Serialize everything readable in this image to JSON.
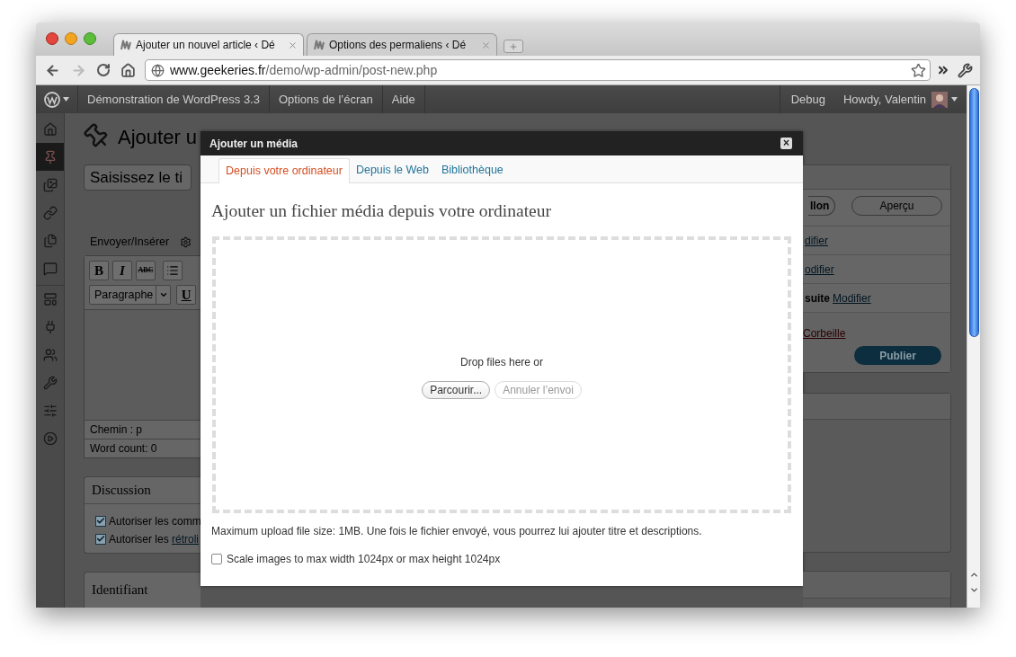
{
  "browser": {
    "tabs": [
      {
        "title": "Ajouter un nouvel article ‹ Dé",
        "selected": true
      },
      {
        "title": "Options des permaliens ‹ Dé",
        "selected": false
      }
    ],
    "url": {
      "host": "www.geekeries.fr",
      "path": "/demo/wp-admin/post-new.php"
    }
  },
  "admin_bar": {
    "left_items": [
      "Démonstration de WordPress 3.3",
      "Options de l’écran",
      "Aide"
    ],
    "right_items": [
      "Debug"
    ],
    "greeting": "Howdy, Valentin"
  },
  "sidebar": {
    "items": [
      {
        "kind": "home",
        "selected": false
      },
      {
        "kind": "posts",
        "selected": true
      },
      {
        "kind": "media",
        "selected": false
      },
      {
        "kind": "links",
        "selected": false
      },
      {
        "kind": "pages",
        "selected": false
      },
      {
        "kind": "comments",
        "selected": false
      },
      {
        "kind": "appearance",
        "selected": false
      },
      {
        "kind": "plugins",
        "selected": false
      },
      {
        "kind": "users",
        "selected": false
      },
      {
        "kind": "tools",
        "selected": false
      },
      {
        "kind": "settings",
        "selected": false
      },
      {
        "kind": "collapse",
        "selected": false
      }
    ]
  },
  "editor": {
    "heading": "Ajouter u",
    "title_placeholder": "Saisissez le ti",
    "upload_label": "Envoyer/Insérer",
    "buttons": [
      "B",
      "I",
      "ABC"
    ],
    "format": "Paragraphe",
    "underline": "U",
    "path": "Chemin : p",
    "word_count": "Word count: 0"
  },
  "discussion": {
    "title": "Discussion",
    "options": [
      {
        "label": "Autoriser les comm",
        "checked": true
      },
      {
        "label": "Autoriser les ",
        "link": "rétroli",
        "checked": true
      }
    ]
  },
  "identifiant": {
    "title": "Identifiant"
  },
  "publish_box": {
    "draft_button": "llon",
    "preview_button": "Aperçu",
    "rows": [
      {
        "link": "difier"
      },
      {
        "link": "odifier"
      },
      {
        "label": "suite",
        "link": "Modifier"
      }
    ],
    "trash": "Corbeille",
    "publish_button": "Publier"
  },
  "modal": {
    "title": "Ajouter un média",
    "close": "×",
    "tabs": [
      {
        "label": "Depuis votre ordinateur",
        "selected": true
      },
      {
        "label": "Depuis le Web",
        "selected": false
      },
      {
        "label": "Bibliothèque",
        "selected": false
      }
    ],
    "heading": "Ajouter un fichier média depuis votre ordinateur",
    "drop_text": "Drop files here or",
    "browse_button": "Parcourir...",
    "cancel_button": {
      "label": "Annuler l’envoi",
      "disabled": true
    },
    "info": "Maximum upload file size: 1MB. Une fois le fichier envoyé, vous pourrez lui ajouter titre et descriptions.",
    "scale_option": {
      "label": "Scale images to max width 1024px or max height 1024px",
      "checked": false
    }
  }
}
